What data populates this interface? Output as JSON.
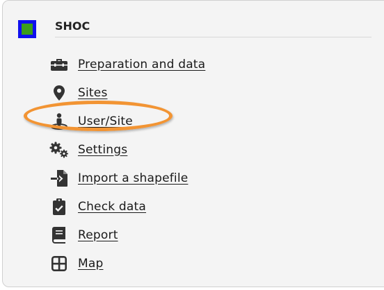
{
  "header": {
    "title": "SHOC",
    "logo_outer_color": "#1010ee",
    "logo_inner_color": "#3c9e1a"
  },
  "menu": {
    "items": [
      {
        "label": "Preparation and data",
        "icon": "briefcase-icon"
      },
      {
        "label": "Sites",
        "icon": "map-marker-icon"
      },
      {
        "label": "User/Site",
        "icon": "street-view-icon"
      },
      {
        "label": "Settings",
        "icon": "cogs-icon"
      },
      {
        "label": "Import a shapefile",
        "icon": "file-import-icon"
      },
      {
        "label": "Check data",
        "icon": "clipboard-check-icon"
      },
      {
        "label": "Report",
        "icon": "book-icon"
      },
      {
        "label": "Map",
        "icon": "grid-icon"
      }
    ]
  },
  "highlight": {
    "target": "User/Site",
    "color": "#f29433"
  }
}
